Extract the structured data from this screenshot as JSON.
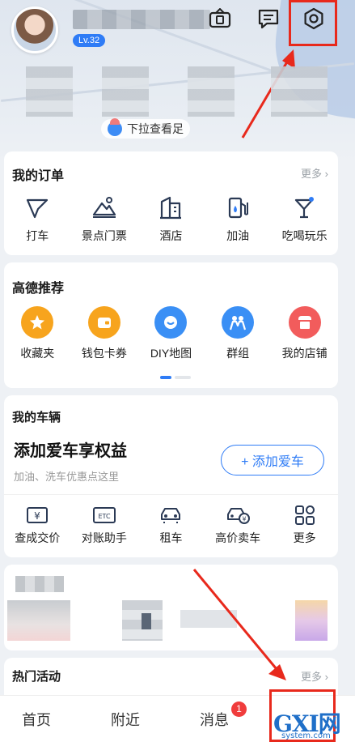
{
  "header": {
    "level": "Lv.32",
    "pull_hint": "下拉查看足"
  },
  "orders": {
    "title": "我的订单",
    "more": "更多",
    "items": [
      {
        "label": "打车",
        "icon": "taxi-flag-icon"
      },
      {
        "label": "景点门票",
        "icon": "scenic-ticket-icon"
      },
      {
        "label": "酒店",
        "icon": "hotel-icon"
      },
      {
        "label": "加油",
        "icon": "fuel-pump-icon"
      },
      {
        "label": "吃喝玩乐",
        "icon": "cocktail-icon"
      }
    ]
  },
  "recommend": {
    "title": "高德推荐",
    "items": [
      {
        "label": "收藏夹",
        "icon": "star-icon",
        "color": "#f7a41d"
      },
      {
        "label": "钱包卡券",
        "icon": "wallet-icon",
        "color": "#f7a41d"
      },
      {
        "label": "DIY地图",
        "icon": "diy-map-icon",
        "color": "#3a8ff5"
      },
      {
        "label": "群组",
        "icon": "group-icon",
        "color": "#3a8ff5"
      },
      {
        "label": "我的店铺",
        "icon": "shop-icon",
        "color": "#f25c5c"
      }
    ]
  },
  "vehicles": {
    "title": "我的车辆",
    "headline": "添加爱车享权益",
    "subtitle": "加油、洗车优惠点这里",
    "add_button": "+ 添加爱车",
    "items": [
      {
        "label": "查成交价",
        "icon": "price-check-icon"
      },
      {
        "label": "对账助手",
        "icon": "etc-icon"
      },
      {
        "label": "租车",
        "icon": "car-rental-icon"
      },
      {
        "label": "高价卖车",
        "icon": "sell-car-icon"
      },
      {
        "label": "更多",
        "icon": "grid-more-icon"
      }
    ]
  },
  "hot": {
    "title": "热门活动",
    "more": "更多"
  },
  "bottom_nav": {
    "items": [
      "首页",
      "附近",
      "消息"
    ],
    "message_badge": "1"
  },
  "watermark": {
    "main": "GXI网",
    "sub": "system.com"
  },
  "colors": {
    "accent": "#2f7cf6",
    "highlight": "#e8291c",
    "badge": "#f03c3c"
  }
}
